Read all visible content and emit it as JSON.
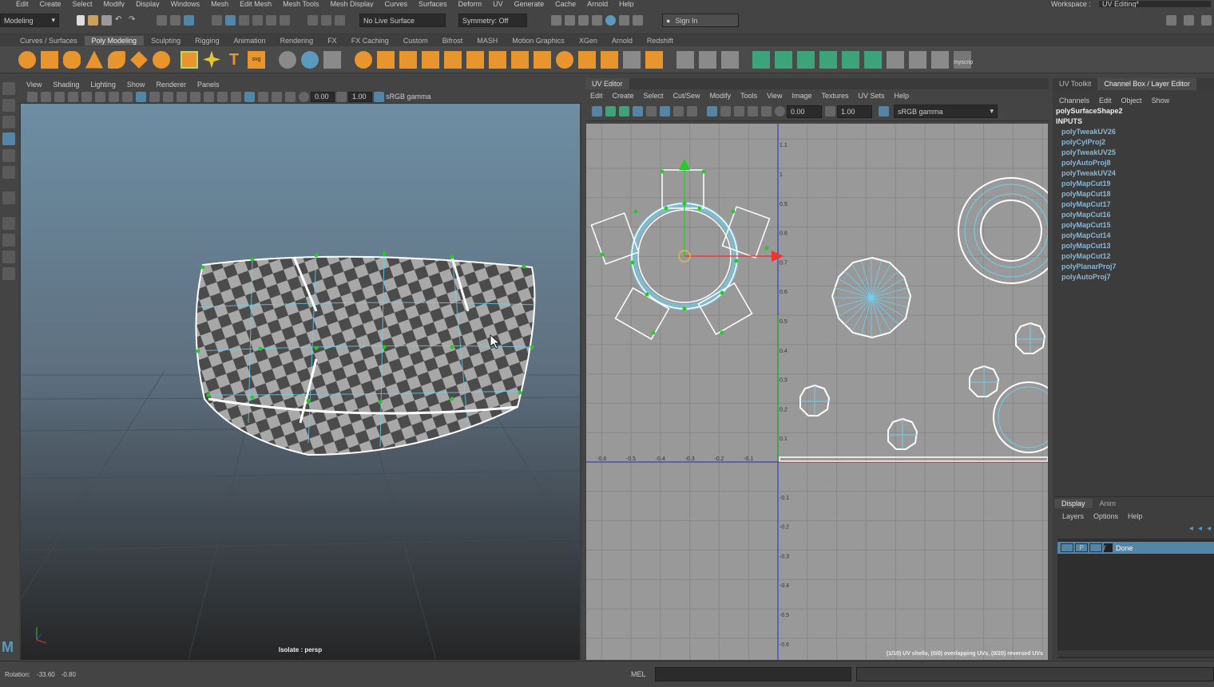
{
  "menubar": [
    "Edit",
    "Create",
    "Select",
    "Modify",
    "Display",
    "Windows",
    "Mesh",
    "Edit Mesh",
    "Mesh Tools",
    "Mesh Display",
    "Curves",
    "Surfaces",
    "Deform",
    "UV",
    "Generate",
    "Cache",
    "Arnold",
    "Help"
  ],
  "workspace": {
    "label": "Workspace :",
    "value": "UV Editing*"
  },
  "status": {
    "mode": "Modeling",
    "live_surface": "No Live Surface",
    "symmetry": "Symmetry: Off",
    "sign_in": "Sign In"
  },
  "shelf_tabs": [
    "Curves / Surfaces",
    "Poly Modeling",
    "Sculpting",
    "Rigging",
    "Animation",
    "Rendering",
    "FX",
    "FX Caching",
    "Custom",
    "Bifrost",
    "MASH",
    "Motion Graphics",
    "XGen",
    "Arnold",
    "Redshift"
  ],
  "shelf_active": "Poly Modeling",
  "shelf_script_label": "myscrip",
  "viewport": {
    "menus": [
      "View",
      "Shading",
      "Lighting",
      "Show",
      "Renderer",
      "Panels"
    ],
    "exposure": "0.00",
    "gamma": "1.00",
    "color_space": "sRGB gamma",
    "isolate": "Isolate : persp"
  },
  "uv_editor": {
    "title": "UV Editor",
    "menus": [
      "Edit",
      "Create",
      "Select",
      "Cut/Sew",
      "Modify",
      "Tools",
      "View",
      "Image",
      "Textures",
      "UV Sets",
      "Help"
    ],
    "exposure": "0.00",
    "gamma": "1.00",
    "color_space": "sRGB gamma",
    "status": "(1/10) UV shells, (0/0) overlapping UVs, (0/20) reversed UVs",
    "v_ticks": [
      "1.1",
      "1",
      "0.9",
      "0.8",
      "0.7",
      "0.6",
      "0.5",
      "0.4",
      "0.3",
      "0.2",
      "0.1",
      "-0.1",
      "-0.2",
      "-0.3",
      "-0.4",
      "-0.5",
      "-0.6"
    ],
    "u_ticks": [
      "-0.6",
      "-0.5",
      "-0.4",
      "-0.3",
      "-0.2",
      "-0.1"
    ]
  },
  "channel_box": {
    "tabs": [
      "UV Toolkit",
      "Channel Box / Layer Editor"
    ],
    "active_tab": "Channel Box / Layer Editor",
    "menus": [
      "Channels",
      "Edit",
      "Object",
      "Show"
    ],
    "shape": "polySurfaceShape2",
    "inputs_label": "INPUTS",
    "inputs": [
      "polyTweakUV26",
      "polyCylProj2",
      "polyTweakUV25",
      "polyAutoProj8",
      "polyTweakUV24",
      "polyMapCut19",
      "polyMapCut18",
      "polyMapCut17",
      "polyMapCut16",
      "polyMapCut15",
      "polyMapCut14",
      "polyMapCut13",
      "polyMapCut12",
      "polyPlanarProj7",
      "polyAutoProj7"
    ]
  },
  "layers": {
    "tabs": [
      "Display",
      "Anim"
    ],
    "menus": [
      "Layers",
      "Options",
      "Help"
    ],
    "layer_p": "P",
    "layer_name": "Done"
  },
  "helpline": {
    "rotation_label": "Rotation:",
    "rot_x": "-33.60",
    "rot_y": "-0.80",
    "mel": "MEL"
  },
  "colors": {
    "accent": "#5285a6",
    "uv_edge": "#6fd0f0",
    "vertex": "#22cc22",
    "orange": "#e8952e"
  }
}
